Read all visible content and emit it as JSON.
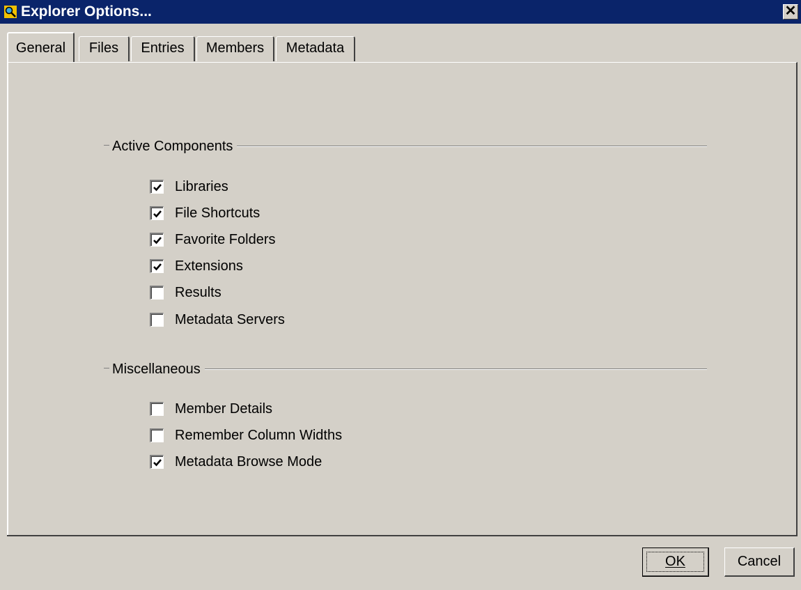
{
  "window": {
    "title": "Explorer Options...",
    "close_symbol": "✕",
    "icon": "magnifier-app-icon"
  },
  "tabs": [
    {
      "label": "General",
      "active": true
    },
    {
      "label": "Files",
      "active": false
    },
    {
      "label": "Entries",
      "active": false
    },
    {
      "label": "Members",
      "active": false
    },
    {
      "label": "Metadata",
      "active": false
    }
  ],
  "groups": {
    "active_components": {
      "label": "Active Components",
      "items": [
        {
          "label": "Libraries",
          "checked": true
        },
        {
          "label": "File Shortcuts",
          "checked": true
        },
        {
          "label": "Favorite Folders",
          "checked": true
        },
        {
          "label": "Extensions",
          "checked": true
        },
        {
          "label": "Results",
          "checked": false
        },
        {
          "label": "Metadata Servers",
          "checked": false
        }
      ]
    },
    "miscellaneous": {
      "label": "Miscellaneous",
      "items": [
        {
          "label": "Member Details",
          "checked": false
        },
        {
          "label": "Remember Column Widths",
          "checked": false
        },
        {
          "label": "Metadata Browse Mode",
          "checked": true
        }
      ]
    }
  },
  "buttons": {
    "ok": "OK",
    "cancel": "Cancel"
  },
  "colors": {
    "titlebar": "#0a246a",
    "face": "#d4d0c8"
  }
}
